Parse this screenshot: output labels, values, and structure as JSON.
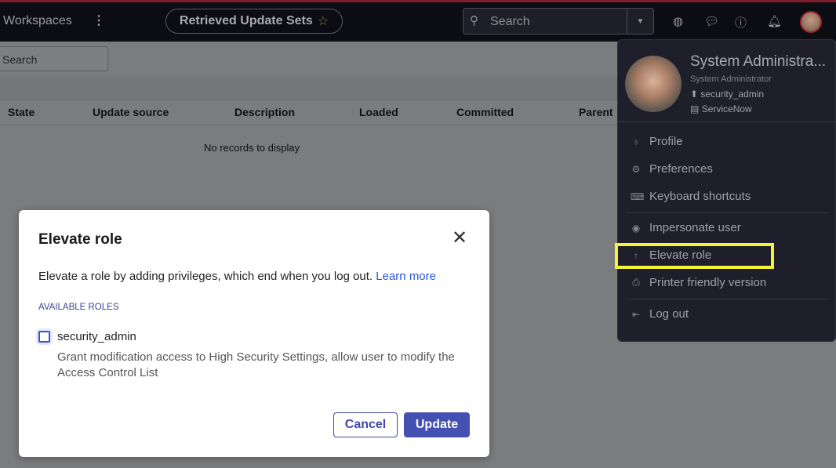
{
  "header": {
    "workspaces": "Workspaces",
    "title": "Retrieved Update Sets",
    "search_placeholder": "Search"
  },
  "list": {
    "filter_placeholder": "Search",
    "columns": [
      "State",
      "Update source",
      "Description",
      "Loaded",
      "Committed",
      "Parent"
    ],
    "empty": "No records to display"
  },
  "user_menu": {
    "name": "System Administra...",
    "title": "System Administrator",
    "elevated_role": "security_admin",
    "instance": "ServiceNow",
    "items": [
      {
        "label": "Profile",
        "icon": "user-icon"
      },
      {
        "label": "Preferences",
        "icon": "gear-icon"
      },
      {
        "label": "Keyboard shortcuts",
        "icon": "keyboard-icon"
      },
      {
        "label": "Impersonate user",
        "icon": "eye-icon"
      },
      {
        "label": "Elevate role",
        "icon": "arrow-up-icon"
      },
      {
        "label": "Printer friendly version",
        "icon": "printer-icon"
      },
      {
        "label": "Log out",
        "icon": "logout-icon"
      }
    ]
  },
  "modal": {
    "title": "Elevate role",
    "description": "Elevate a role by adding privileges, which end when you log out.",
    "learn_more": "Learn more",
    "section": "AVAILABLE ROLES",
    "role": {
      "name": "security_admin",
      "checked": false,
      "description": "Grant modification access to High Security Settings, allow user to modify the Access Control List"
    },
    "cancel": "Cancel",
    "update": "Update"
  },
  "colors": {
    "highlight": "#f5f23a",
    "primary": "#4450b2",
    "link": "#2a55d8"
  }
}
